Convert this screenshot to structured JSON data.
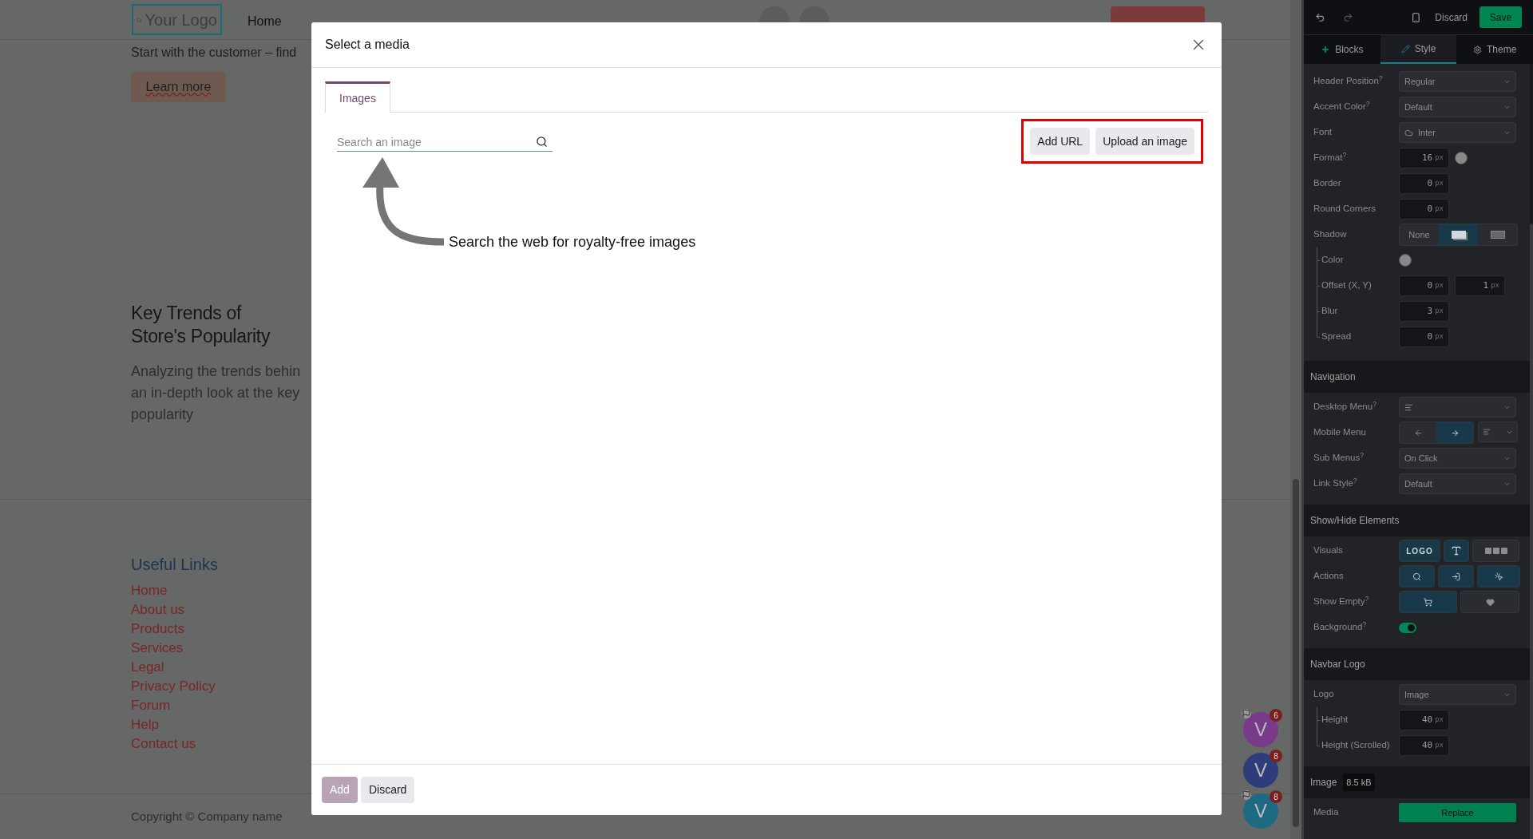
{
  "website": {
    "logo": "Your Logo",
    "nav": [
      "Home"
    ],
    "intro": "Start with the customer – find",
    "learn_more": "Learn more",
    "heading": [
      "Key Trends of",
      "Store's Popularity"
    ],
    "paragraph": [
      "Analyzing the trends behin",
      "an in-depth look at the key",
      "popularity"
    ],
    "links_title": "Useful Links",
    "links": [
      "Home",
      "About us",
      "Products",
      "Services",
      "Legal",
      "Privacy Policy",
      "Forum",
      "Help",
      "Contact us"
    ],
    "copyright": "Copyright © Company name"
  },
  "chat_bubbles": [
    {
      "letter": "V",
      "count": "6",
      "color": "#7a3a8a",
      "flagged": true
    },
    {
      "letter": "V",
      "count": "8",
      "color": "#2e3c7c",
      "flagged": false
    },
    {
      "letter": "V",
      "count": "8",
      "color": "#1d6a82",
      "flagged": true
    }
  ],
  "dialog": {
    "title": "Select a media",
    "tabs": [
      {
        "label": "Images",
        "selected": true
      }
    ],
    "search": {
      "placeholder": "Search an image"
    },
    "actions": [
      "Add URL",
      "Upload an image"
    ],
    "actions_highlighted": true,
    "hint": "Search the web for royalty-free images",
    "footer": [
      {
        "label": "Add",
        "kind": "primary",
        "disabled": true
      },
      {
        "label": "Discard",
        "kind": "secondary",
        "disabled": false
      }
    ]
  },
  "editor": {
    "discard": "Discard",
    "save": "Save",
    "tabs": [
      {
        "label": "Blocks",
        "selected": false
      },
      {
        "label": "Style",
        "selected": true
      },
      {
        "label": "Theme",
        "selected": false
      }
    ],
    "sections": [
      {
        "rows": [
          {
            "label": "Header Position$^{?}$",
            "kind": "select",
            "value": "Regular"
          },
          {
            "label": "Accent Color$^{?}$",
            "kind": "select",
            "value": "Default"
          },
          {
            "label": "Font",
            "kind": "select",
            "value": "Inter"
          },
          {
            "label": "Format$^{?}$",
            "kind": "number",
            "fields": [
              {
                "value": "16",
                "unit": "px"
              }
            ],
            "swatch": true
          },
          {
            "label": "Border",
            "kind": "number",
            "fields": [
              {
                "value": "0",
                "unit": "px"
              }
            ]
          },
          {
            "label": "Round Corners",
            "kind": "number",
            "fields": [
              {
                "value": "0",
                "unit": "px"
              }
            ]
          },
          {
            "label": "Shadow",
            "kind": "shadow",
            "options": [
              {
                "label": "None",
                "selected": false
              },
              {
                "selected": true
              },
              {
                "selected": false
              }
            ],
            "children": [
              {
                "label": "Color",
                "kind": "color"
              },
              {
                "label": "Offset (X, Y)",
                "kind": "number",
                "fields": [
                  {
                    "value": "0",
                    "unit": "px"
                  },
                  {
                    "value": "1",
                    "unit": "px"
                  }
                ]
              },
              {
                "label": "Blur",
                "kind": "number",
                "fields": [
                  {
                    "value": "3",
                    "unit": "px"
                  }
                ]
              },
              {
                "label": "Spread",
                "kind": "number",
                "fields": [
                  {
                    "value": "0",
                    "unit": "px"
                  }
                ]
              }
            ]
          }
        ]
      },
      {
        "title": "Navigation",
        "rows": [
          {
            "label": "Desktop Menu$^{?}$",
            "kind": "menu_select"
          },
          {
            "label": "Mobile Menu",
            "kind": "mobile_menu",
            "options": [
              {
                "selected": false
              },
              {
                "selected": true
              }
            ]
          },
          {
            "label": "Sub Menus$^{?}$",
            "kind": "select",
            "value": "On Click"
          },
          {
            "label": "Link Style$^{?}$",
            "kind": "select",
            "value": "Default"
          }
        ]
      },
      {
        "title": "Show/Hide Elements",
        "rows": [
          {
            "label": "Visuals",
            "kind": "visuals",
            "options": [
              {
                "label": "LOGO",
                "selected": true
              },
              {
                "selected": true
              },
              {
                "selected": false
              }
            ]
          },
          {
            "label": "Actions",
            "kind": "actions",
            "options": [
              {
                "selected": true
              },
              {
                "selected": true
              },
              {
                "selected": true
              }
            ]
          },
          {
            "label": "Show Empty$^{?}$",
            "kind": "show_empty",
            "options": [
              {
                "selected": true
              },
              {
                "selected": false
              }
            ]
          },
          {
            "label": "Background$^{?}$",
            "kind": "toggle",
            "on": true
          }
        ]
      },
      {
        "title": "Navbar Logo",
        "rows": [
          {
            "label": "Logo",
            "kind": "select",
            "value": "Image",
            "children": [
              {
                "label": "Height",
                "kind": "number",
                "fields": [
                  {
                    "value": "40",
                    "unit": "px"
                  }
                ]
              },
              {
                "label": "Height (Scrolled)",
                "kind": "number",
                "fields": [
                  {
                    "value": "40",
                    "unit": "px"
                  }
                ]
              }
            ]
          }
        ]
      },
      {
        "title": "Image",
        "badge": "8.5 kB",
        "rows": [
          {
            "label": "Media",
            "kind": "button",
            "value": "Replace"
          }
        ]
      }
    ]
  }
}
